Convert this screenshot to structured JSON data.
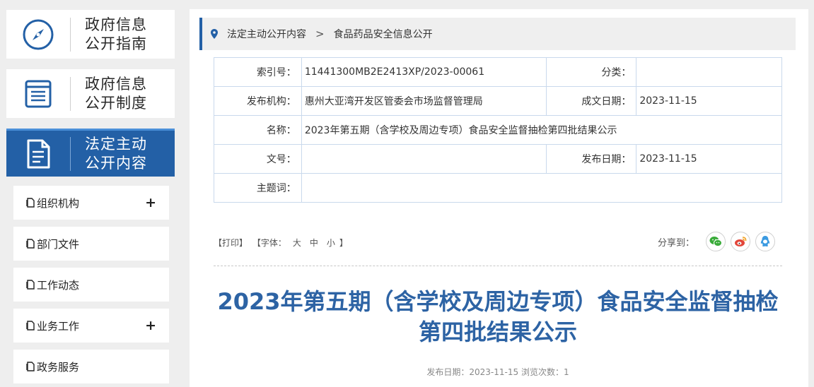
{
  "sidebar": {
    "guide": {
      "line1": "政府信息",
      "line2": "公开指南",
      "icon": "compass-icon"
    },
    "system": {
      "line1": "政府信息",
      "line2": "公开制度",
      "icon": "document-list-icon"
    },
    "content": {
      "line1": "法定主动",
      "line2": "公开内容",
      "icon": "document-icon"
    },
    "menu": [
      {
        "label": "组织机构",
        "expand": "+"
      },
      {
        "label": "部门文件",
        "expand": ""
      },
      {
        "label": "工作动态",
        "expand": ""
      },
      {
        "label": "业务工作",
        "expand": "+"
      },
      {
        "label": "政务服务",
        "expand": ""
      }
    ]
  },
  "breadcrumb": {
    "parent": "法定主动公开内容",
    "separator": ">",
    "current": "食品药品安全信息公开"
  },
  "meta": {
    "index_label": "索引号：",
    "index_value": "11441300MB2E2413XP/2023-00061",
    "category_label": "分类：",
    "category_value": "",
    "publisher_label": "发布机构：",
    "publisher_value": "惠州大亚湾开发区管委会市场监督管理局",
    "created_label": "成文日期：",
    "created_value": "2023-11-15",
    "name_label": "名称：",
    "name_value": "2023年第五期（含学校及周边专项）食品安全监督抽检第四批结果公示",
    "docno_label": "文号：",
    "docno_value": "",
    "published_label": "发布日期：",
    "published_value": "2023-11-15",
    "keywords_label": "主题词：",
    "keywords_value": ""
  },
  "tools": {
    "print": "【打印】",
    "font_prefix": "【字体：",
    "font_large": "大",
    "font_medium": "中",
    "font_small": "小",
    "font_suffix": "】",
    "share_label": "分享到："
  },
  "article": {
    "title": "2023年第五期（含学校及周边专项）食品安全监督抽检第四批结果公示",
    "publish_label": "发布日期：",
    "publish_date": "2023-11-15",
    "views_label": "浏览次数：",
    "views_count": "1"
  },
  "colors": {
    "brand": "#2360a6",
    "title": "#2d63a4",
    "wechat": "#3aab3a",
    "weibo": "#e2463a",
    "qq": "#3b9ae1"
  }
}
